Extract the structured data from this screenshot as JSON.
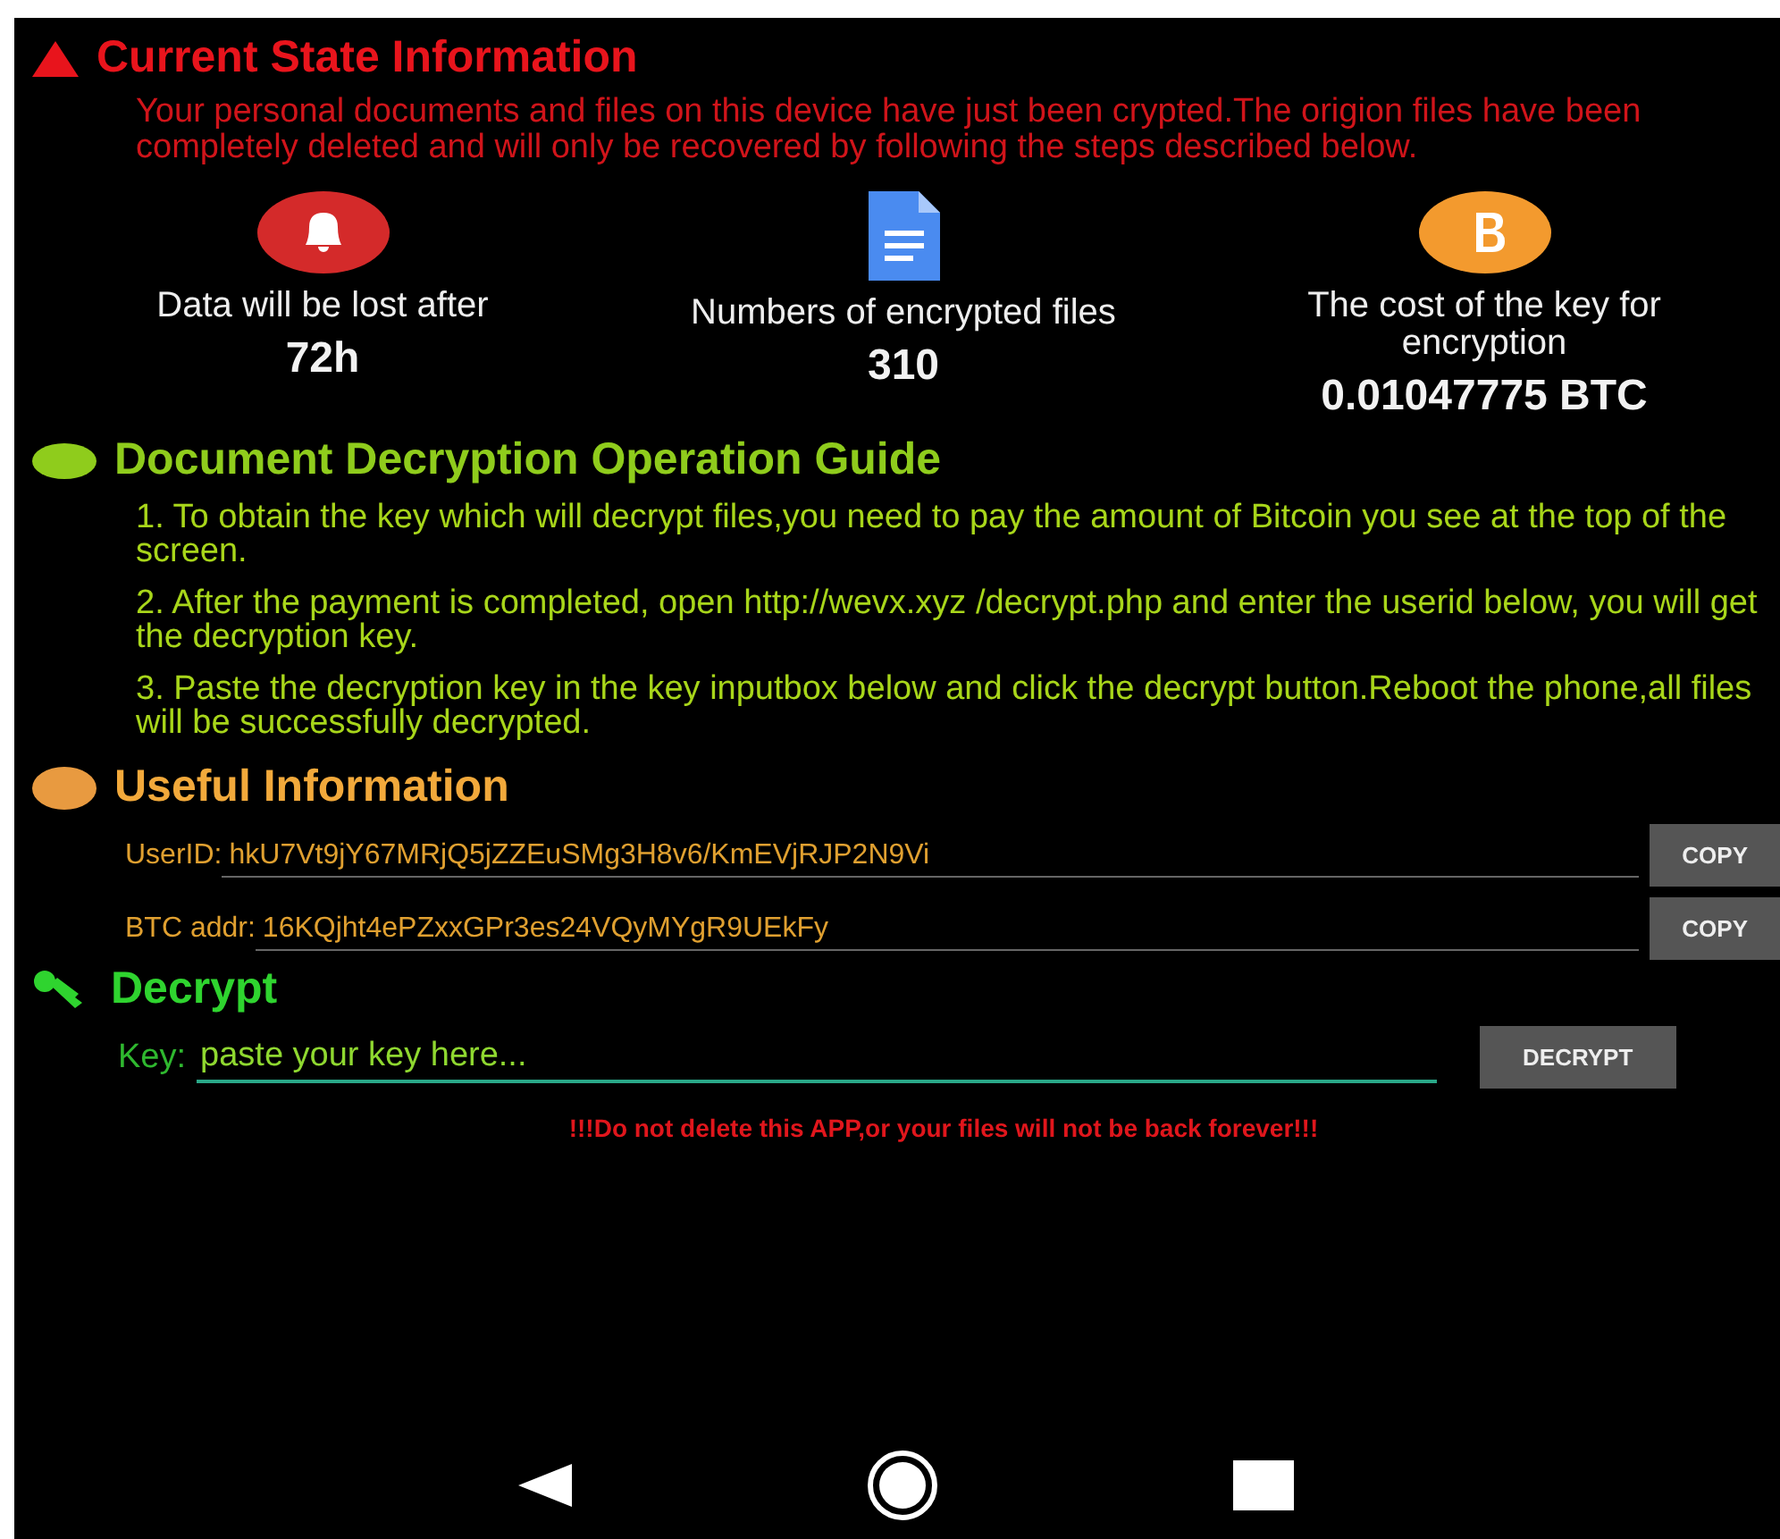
{
  "state_section": {
    "title": "Current State Information",
    "description": "Your personal documents and files on this device have just been crypted.The origion files have been completely deleted and will only be recovered by following the steps described below."
  },
  "stats": [
    {
      "kind": "alarm",
      "label": "Data will be lost after",
      "value": "72h"
    },
    {
      "kind": "document",
      "label": "Numbers of encrypted files",
      "value": "310"
    },
    {
      "kind": "coin",
      "label": "The cost of the key for encryption",
      "value": "0.01047775 BTC"
    }
  ],
  "guide_section": {
    "title": "Document Decryption Operation Guide",
    "steps": [
      "1. To obtain the key which will decrypt files,you need to pay the amount of Bitcoin you see at the top of the screen.",
      "2. After the payment is completed, open http://wevx.xyz /decrypt.php and enter the userid below, you will get the decryption key.",
      "3. Paste the decryption key in the key inputbox below and click the decrypt button.Reboot the phone,all files will be successfully decrypted."
    ]
  },
  "info_section": {
    "title": "Useful Information",
    "fields": [
      {
        "label": "UserID:",
        "value": "hkU7Vt9jY67MRjQ5jZZEuSMg3H8v6/KmEVjRJP2N9Vi",
        "button": "COPY"
      },
      {
        "label": "BTC addr:",
        "value": "16KQjht4ePZxxGPr3es24VQyMYgR9UEkFy",
        "button": "COPY"
      }
    ]
  },
  "decrypt_section": {
    "title": "Decrypt",
    "label": "Key:",
    "placeholder": "paste your key here...",
    "button": "DECRYPT"
  },
  "warning": "!!!Do not delete this APP,or your files will not be back forever!!!"
}
